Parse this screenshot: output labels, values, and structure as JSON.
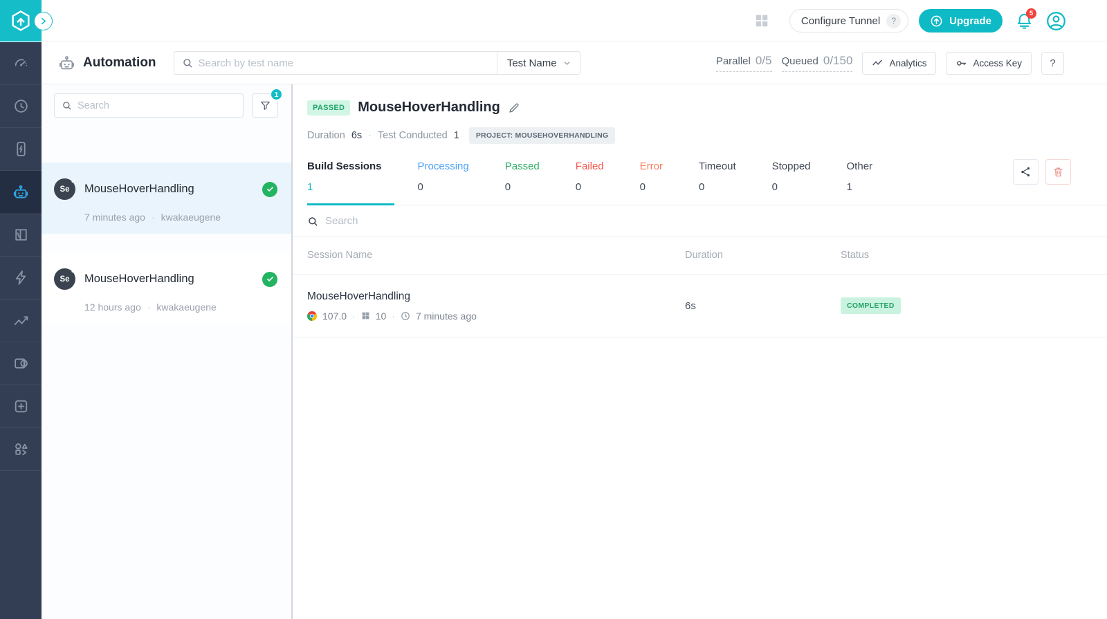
{
  "brand_colors": {
    "teal": "#0ebac5",
    "sidebar_bg": "#333e54",
    "sidebar_active_bg": "#242e43",
    "sidebar_active_icon": "#2ea7e3",
    "selected_item_bg": "#eaf4fc",
    "success_green": "#22b460",
    "passed_badge_bg": "#d2f6e5",
    "passed_badge_text": "#1ea469",
    "notification_red": "#f0433c",
    "tab_processing": "#4da1f5",
    "tab_passed": "#2fac66",
    "tab_failed": "#f4564e",
    "tab_error": "#fa7e5c"
  },
  "topbar": {
    "configure_tunnel_label": "Configure Tunnel",
    "configure_tunnel_help": "?",
    "upgrade_label": "Upgrade",
    "notification_count": "5"
  },
  "header": {
    "title": "Automation",
    "search_placeholder": "Search by test name",
    "search_by_label": "Test Name",
    "parallel_label": "Parallel",
    "parallel_value": "0/5",
    "queued_label": "Queued",
    "queued_value": "0/150",
    "analytics_label": "Analytics",
    "access_key_label": "Access Key",
    "help_label": "?"
  },
  "sidebar": {
    "items": [
      {
        "icon": "gauge-icon",
        "active": false
      },
      {
        "icon": "clock-history-icon",
        "active": false
      },
      {
        "icon": "mobile-bolt-icon",
        "active": false
      },
      {
        "icon": "robot-icon",
        "active": true
      },
      {
        "icon": "browser-panels-icon",
        "active": false
      },
      {
        "icon": "lightning-icon",
        "active": false
      },
      {
        "icon": "trend-chart-icon",
        "active": false
      },
      {
        "icon": "contrast-panel-icon",
        "active": false
      },
      {
        "icon": "plus-square-icon",
        "active": false
      },
      {
        "icon": "shapes-icon",
        "active": false
      }
    ]
  },
  "test_list": {
    "search_placeholder": "Search",
    "filter_badge": "1",
    "items": [
      {
        "framework": "Se",
        "framework_check": "✓",
        "title": "MouseHoverHandling",
        "time": "7 minutes ago",
        "separator": "·",
        "user": "kwakaeugene",
        "status": "passed",
        "selected": true
      },
      {
        "framework": "Se",
        "framework_check": "✓",
        "title": "MouseHoverHandling",
        "time": "12 hours ago",
        "separator": "·",
        "user": "kwakaeugene",
        "status": "passed",
        "selected": false
      }
    ]
  },
  "main": {
    "status_badge": "PASSED",
    "title": "MouseHoverHandling",
    "duration_label": "Duration",
    "duration_value": "6s",
    "separator": "·",
    "tests_label": "Test Conducted",
    "tests_value": "1",
    "project_badge": "PROJECT: MOUSEHOVERHANDLING",
    "tabs": [
      {
        "label": "Build Sessions",
        "count": "1",
        "active": true
      },
      {
        "label": "Processing",
        "count": "0",
        "active": false
      },
      {
        "label": "Passed",
        "count": "0",
        "active": false
      },
      {
        "label": "Failed",
        "count": "0",
        "active": false
      },
      {
        "label": "Error",
        "count": "0",
        "active": false
      },
      {
        "label": "Timeout",
        "count": "0",
        "active": false
      },
      {
        "label": "Stopped",
        "count": "0",
        "active": false
      },
      {
        "label": "Other",
        "count": "1",
        "active": false
      }
    ],
    "table": {
      "search_placeholder": "Search",
      "columns": [
        "Session Name",
        "Duration",
        "Status"
      ],
      "rows": [
        {
          "name": "MouseHoverHandling",
          "browser_version": "107.0",
          "sep1": "·",
          "os_version": "10",
          "sep2": "·",
          "time": "7 minutes ago",
          "duration": "6s",
          "status": "COMPLETED"
        }
      ]
    }
  }
}
